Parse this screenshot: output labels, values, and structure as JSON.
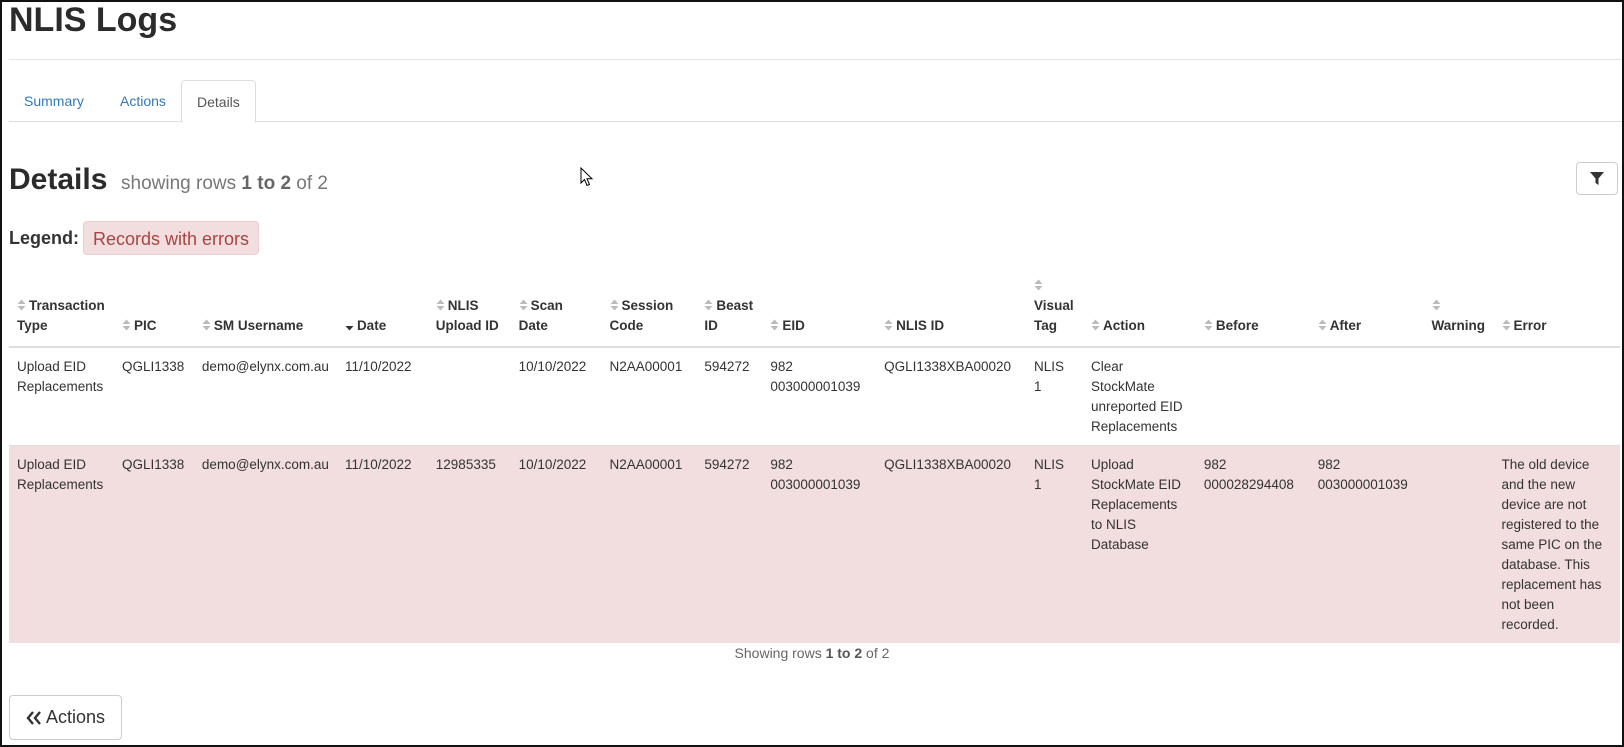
{
  "page": {
    "title": "NLIS Logs"
  },
  "tabs": [
    {
      "label": "Summary"
    },
    {
      "label": "Actions"
    },
    {
      "label": "Details",
      "active": true
    }
  ],
  "details": {
    "title": "Details",
    "showing_prefix": "showing rows ",
    "range": "1 to 2",
    "of_label": " of ",
    "total": "2",
    "filter_icon": "filter-icon"
  },
  "legend": {
    "label": "Legend:",
    "badge": "Records with errors",
    "badge_color": "#f2dede"
  },
  "table": {
    "columns": [
      {
        "label": "Transaction Type",
        "sort": "none"
      },
      {
        "label": "PIC",
        "sort": "none"
      },
      {
        "label": "SM Username",
        "sort": "none"
      },
      {
        "label": "Date",
        "sort": "desc"
      },
      {
        "label": "NLIS Upload ID",
        "sort": "none"
      },
      {
        "label": "Scan Date",
        "sort": "none"
      },
      {
        "label": "Session Code",
        "sort": "none"
      },
      {
        "label": "Beast ID",
        "sort": "none"
      },
      {
        "label": "EID",
        "sort": "none"
      },
      {
        "label": "NLIS ID",
        "sort": "none"
      },
      {
        "label": "Visual Tag",
        "sort": "none"
      },
      {
        "label": "Action",
        "sort": "none"
      },
      {
        "label": "Before",
        "sort": "none"
      },
      {
        "label": "After",
        "sort": "none"
      },
      {
        "label": "Warning",
        "sort": "none"
      },
      {
        "label": "Error",
        "sort": "none"
      }
    ],
    "rows": [
      {
        "error": false,
        "cells": [
          "Upload EID Replacements",
          "QGLI1338",
          "demo@elynx.com.au",
          "11/10/2022",
          "",
          "10/10/2022",
          "N2AA00001",
          "594272",
          "982 003000001039",
          "QGLI1338XBA00020",
          "NLIS 1",
          "Clear StockMate unreported EID Replacements",
          "",
          "",
          "",
          ""
        ]
      },
      {
        "error": true,
        "cells": [
          "Upload EID Replacements",
          "QGLI1338",
          "demo@elynx.com.au",
          "11/10/2022",
          "12985335",
          "10/10/2022",
          "N2AA00001",
          "594272",
          "982 003000001039",
          "QGLI1338XBA00020",
          "NLIS 1",
          "Upload StockMate EID Replacements to NLIS Database",
          "982 000028294408",
          "982 003000001039",
          "",
          "The old device and the new device are not registered to the same PIC on the database. This replacement has not been recorded."
        ]
      }
    ]
  },
  "footer": {
    "showing_prefix": "Showing rows ",
    "range": "1 to 2",
    "of_label": " of ",
    "total": "2",
    "back_label": "Actions",
    "back_icon": "double-chevron-left-icon"
  }
}
